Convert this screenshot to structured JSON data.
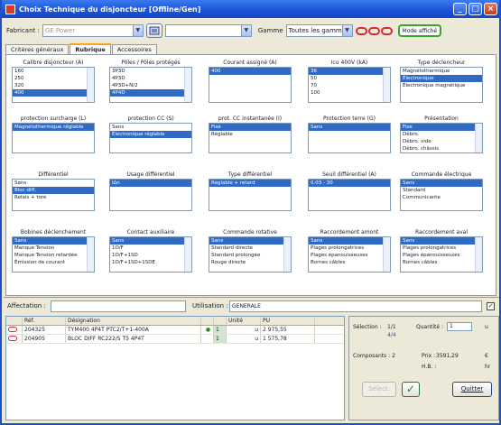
{
  "window": {
    "title": "Choix Technique du disjoncteur [Offline/Gen]",
    "buttons": {
      "minimize": "_",
      "maximize": "□",
      "close": "×"
    }
  },
  "toolbar": {
    "fabricant_label": "Fabricant :",
    "fabricant_value": "GE Power",
    "gamme_label": "Gamme",
    "gamme_value": "Toutes les gammes",
    "badge_text": "Mode affiché"
  },
  "tabs": [
    "Critères généraux",
    "Rubrique",
    "Accessoires"
  ],
  "listboxes": [
    {
      "caption": "Calibre disjoncteur (A)",
      "items": [
        "160",
        "250",
        "320",
        "400"
      ],
      "selected": [
        3
      ]
    },
    {
      "caption": "Pôles / Pôles protégés",
      "items": [
        "3P3D",
        "4P3D",
        "4P3D+N/2",
        "4P4D"
      ],
      "selected": [
        3
      ]
    },
    {
      "caption": "Courant assigné (A)",
      "items": [
        "400"
      ],
      "selected": [
        0
      ]
    },
    {
      "caption": "Icu 400V (kA)",
      "items": [
        "36",
        "50",
        "70",
        "100"
      ],
      "selected": [
        0
      ]
    },
    {
      "caption": "Type déclencheur",
      "items": [
        "Magnétothermique",
        "Électronique",
        "Électronique magnétique"
      ],
      "selected": [
        1
      ]
    },
    {
      "caption": "protection surcharge (L)",
      "items": [
        "Magnétothermique réglable"
      ],
      "selected": [
        0
      ]
    },
    {
      "caption": "protection CC (S)",
      "items": [
        "Sans",
        "Électronique réglable"
      ],
      "selected": [
        1
      ]
    },
    {
      "caption": "prot. CC instantanée (I)",
      "items": [
        "Fixe",
        "Réglable"
      ],
      "selected": [
        0
      ]
    },
    {
      "caption": "Protection terre (G)",
      "items": [
        "Sans"
      ],
      "selected": [
        0
      ]
    },
    {
      "caption": "Présentation",
      "items": [
        "Fixe",
        "Débro.",
        "Débro. vide",
        "Débro. châssis"
      ],
      "selected": [
        0
      ]
    },
    {
      "caption": "Différentiel",
      "items": [
        "Sans",
        "Bloc diff.",
        "Relais + tore"
      ],
      "selected": [
        1
      ]
    },
    {
      "caption": "Usage différentiel",
      "items": [
        "I∆n"
      ],
      "selected": [
        0
      ]
    },
    {
      "caption": "Type différentiel",
      "items": [
        "Réglable + retard"
      ],
      "selected": [
        0
      ]
    },
    {
      "caption": "Seuil différentiel (A)",
      "items": [
        "0.03 - 30"
      ],
      "selected": [
        0
      ]
    },
    {
      "caption": "Commande électrique",
      "items": [
        "Sans",
        "Standard",
        "Communicante"
      ],
      "selected": [
        0
      ]
    },
    {
      "caption": "Bobines déclenchement",
      "items": [
        "Sans",
        "Manque Tension",
        "Manque Tension retardée",
        "Émission de courant"
      ],
      "selected": [
        0
      ]
    },
    {
      "caption": "Contact auxiliaire",
      "items": [
        "Sans",
        "1O/F",
        "1O/F+1SD",
        "1O/F+1SD+1SDE"
      ],
      "selected": [
        0
      ]
    },
    {
      "caption": "Commande rotative",
      "items": [
        "Sans",
        "Standard directe",
        "Standard prolongée",
        "Rouge directe"
      ],
      "selected": [
        0
      ]
    },
    {
      "caption": "Raccordement amont",
      "items": [
        "Sans",
        "Plages prolongatrices",
        "Plages épanouisseuses",
        "Bornes câbles"
      ],
      "selected": [
        0
      ]
    },
    {
      "caption": "Raccordement aval",
      "items": [
        "Sans",
        "Plages prolongatrices",
        "Plages épanouisseuses",
        "Bornes câbles"
      ],
      "selected": [
        0
      ]
    }
  ],
  "affectation": {
    "label": "Affectation :",
    "value": "",
    "utilisation_label": "Utilisation :",
    "utilisation_value": "GENERALE"
  },
  "grid": {
    "headers": [
      "",
      "Réf.",
      "Désignation",
      "",
      "",
      "Unité",
      "PU"
    ],
    "rows": [
      {
        "ref": "204325",
        "designation": "TYM400 4P4T PTC2/T+1-400A",
        "qty": "1",
        "unit": "u",
        "price": "2 975,55"
      },
      {
        "ref": "204905",
        "designation": "BLOC DIFF RC222/S T5 4P4T",
        "qty": "1",
        "unit": "u",
        "price": "1 575,78"
      }
    ]
  },
  "summary": {
    "selection_label": "Sélection :",
    "selection_value": "1/1",
    "selection_sub": "4/4",
    "quantite_label": "Quantité :",
    "quantite_value": "1",
    "quantite_unit": "u",
    "composants_label": "Composants : 2",
    "prix_label": "Prix :",
    "prix_value": "3591,29",
    "prix_currency": "€",
    "hb_label": "H.B. :",
    "hb_unit": "hr",
    "annuler_label": "Quitter",
    "disabled_label": "Sélect."
  }
}
